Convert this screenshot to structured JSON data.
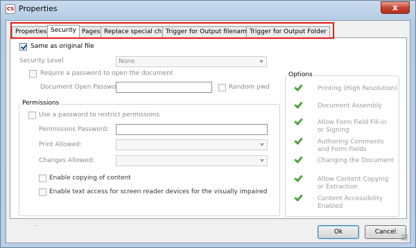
{
  "window": {
    "title": "Properties",
    "app_icon": "pdf-app-icon",
    "close_symbol": "x"
  },
  "tabs": [
    {
      "label": "Properties",
      "active": false
    },
    {
      "label": "Security",
      "active": true
    },
    {
      "label": "Pages",
      "active": false
    },
    {
      "label": "Replace special char",
      "active": false
    },
    {
      "label": "Trigger for Output filename",
      "active": false
    },
    {
      "label": "Trigger for Output Folder",
      "active": false
    }
  ],
  "security": {
    "same_as_original_label": "Same as original file",
    "same_as_original_checked": true,
    "security_level_label": "Security Level",
    "security_level_value": "None",
    "require_password_label": "Require a password to open the document",
    "require_password_checked": false,
    "document_open_password_label": "Document Open Password",
    "document_open_password_value": "",
    "random_pwd_label": "Random pwd",
    "random_pwd_checked": false
  },
  "permissions": {
    "group_label": "Permissions",
    "use_password_label": "Use a password to restrict permissions",
    "use_password_checked": false,
    "permissions_password_label": "Permissions Password:",
    "permissions_password_value": "",
    "print_allowed_label": "Print Allowed:",
    "print_allowed_value": "",
    "changes_allowed_label": "Changes Allowed:",
    "changes_allowed_value": "",
    "enable_copying_label": "Enable copying of content",
    "enable_copying_checked": false,
    "enable_text_access_label": "Enable text access for screen reader devices for the visually impaired",
    "enable_text_access_checked": false,
    "ellipsis": ".."
  },
  "options": {
    "group_label": "Options",
    "items": [
      {
        "line1": "Printing (High Resolution)",
        "line2": ""
      },
      {
        "line1": "Document Assembly",
        "line2": ""
      },
      {
        "line1": "Allow Form Field Fill-in",
        "line2": "or Signing"
      },
      {
        "line1": "Authoring Comments",
        "line2": "and Form Fields"
      },
      {
        "line1": "Changing the Document",
        "line2": ""
      },
      {
        "line1": "Allow Content Copying",
        "line2": "or Extraction"
      },
      {
        "line1": "Content Accessibility",
        "line2": "Enabled"
      }
    ]
  },
  "buttons": {
    "ok": "Ok",
    "cancel": "Cancel"
  },
  "colors": {
    "highlight": "#e21b1b",
    "check_green": "#4ea13c"
  }
}
